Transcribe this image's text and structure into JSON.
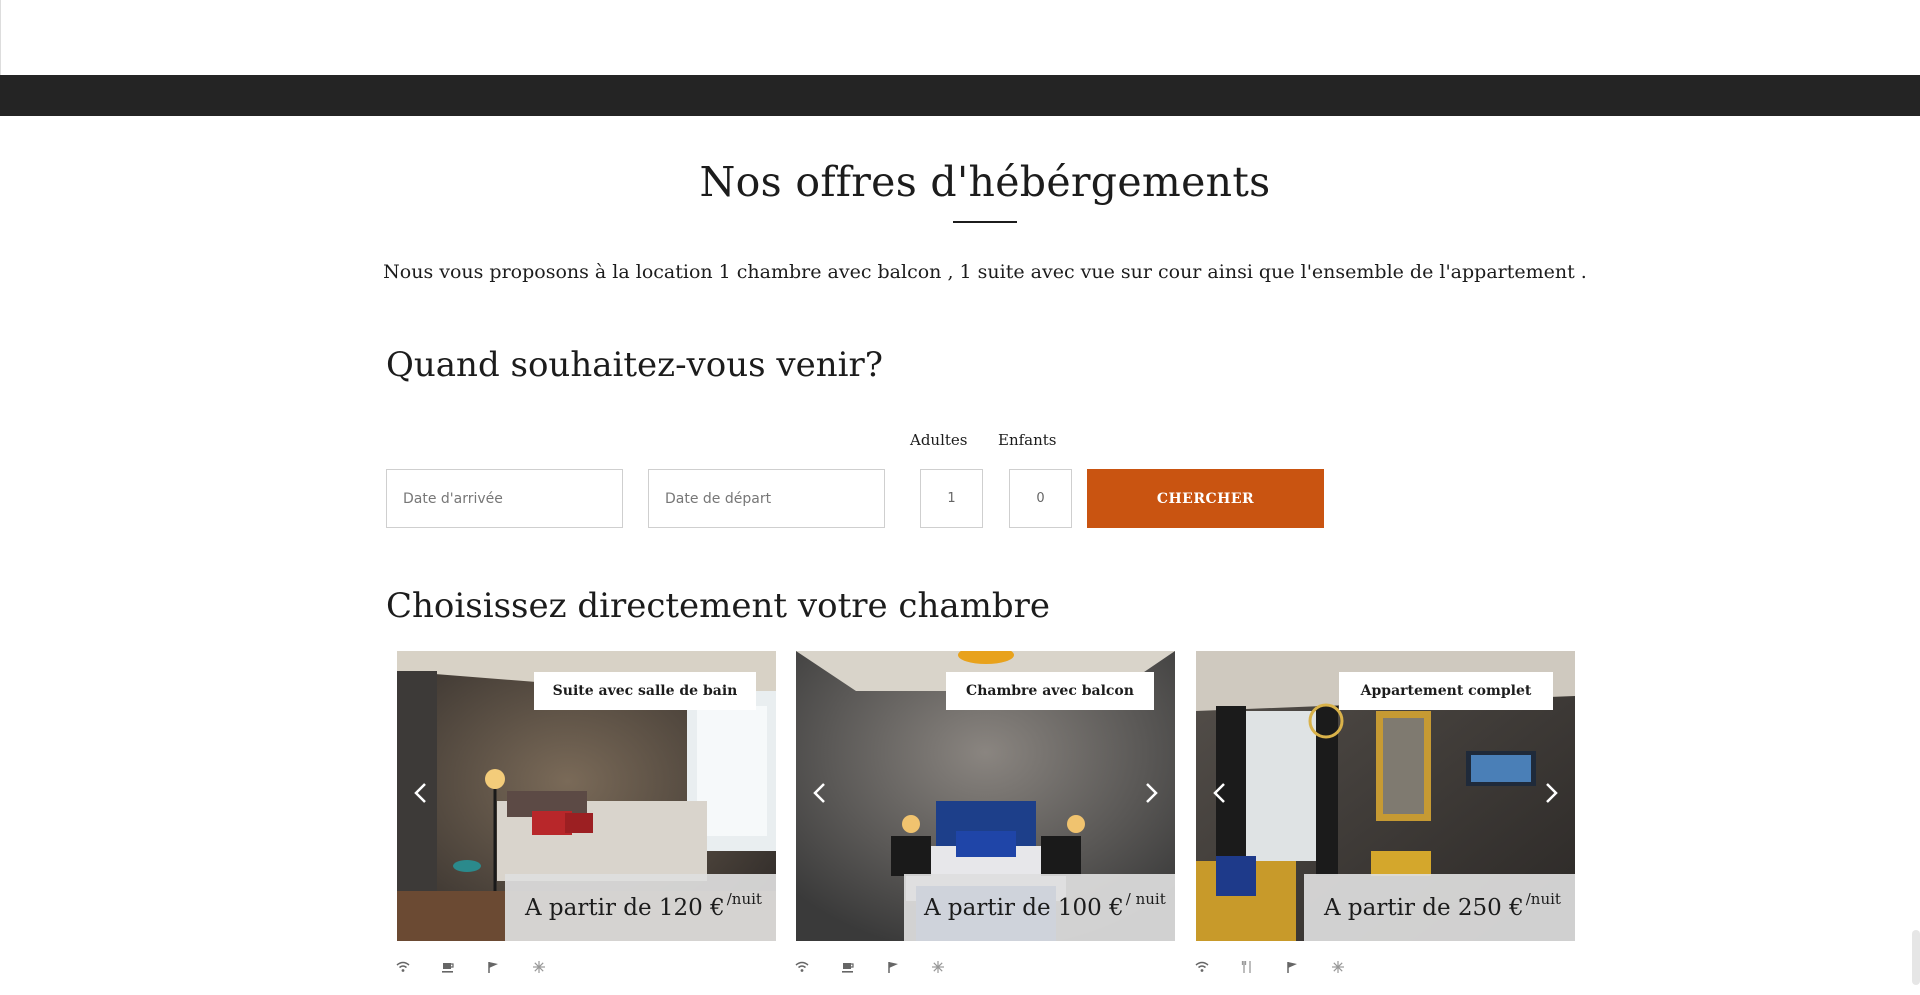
{
  "section": {
    "title": "Nos offres d'hébérgements",
    "intro": "Nous vous proposons à la location 1 chambre avec balcon , 1 suite avec vue sur cour ainsi que l'ensemble de l'appartement ."
  },
  "booking": {
    "title": "Quand souhaitez-vous venir?",
    "arrival_placeholder": "Date d'arrivée",
    "departure_placeholder": "Date de départ",
    "adults_label": "Adultes",
    "children_label": "Enfants",
    "adults_value": "1",
    "children_value": "0",
    "search_label": "CHERCHER"
  },
  "rooms": {
    "title": "Choisissez directement votre chambre",
    "cards": [
      {
        "tag": "Suite avec salle de bain",
        "price": "A partir de 120 €",
        "unit": "/nuit",
        "amenities": [
          "wifi-icon",
          "coffee-icon",
          "flag-icon",
          "snowflake-icon"
        ]
      },
      {
        "tag": "Chambre avec balcon",
        "price": "A partir de 100 €",
        "unit": "/ nuit",
        "amenities": [
          "wifi-icon",
          "coffee-icon",
          "flag-icon",
          "snowflake-icon"
        ]
      },
      {
        "tag": "Appartement complet",
        "price": "A partir de 250 €",
        "unit": "/nuit",
        "amenities": [
          "wifi-icon",
          "cutlery-icon",
          "flag-icon",
          "snowflake-icon"
        ]
      }
    ]
  },
  "colors": {
    "accent": "#c95411",
    "dark_bar": "#242424",
    "text": "#1c1c1c"
  }
}
